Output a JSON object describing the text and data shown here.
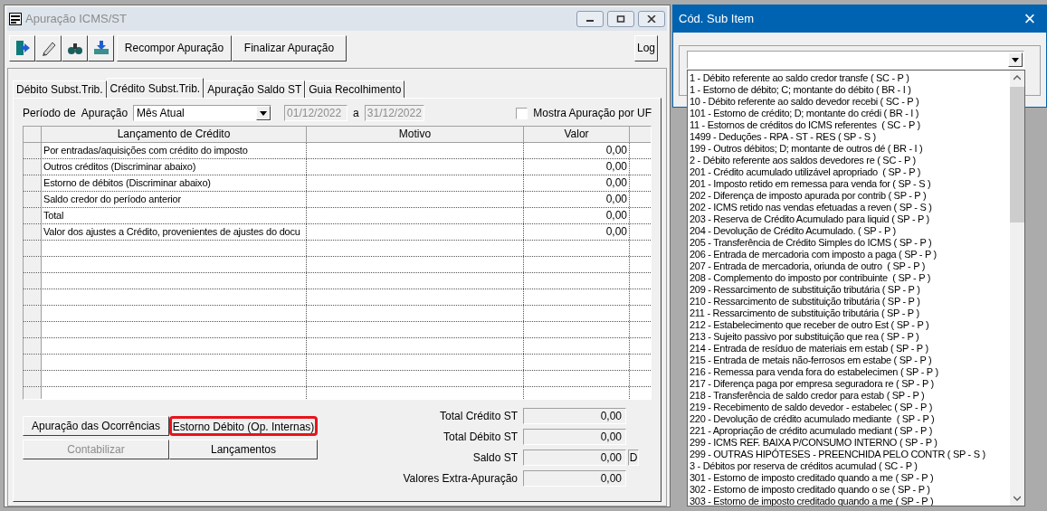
{
  "main_window": {
    "title": "Apuração ICMS/ST",
    "toolbar": {
      "buttons": [
        "Recompor Apuração",
        "Finalizar Apuração"
      ],
      "log_button": "Log"
    },
    "tabs": [
      {
        "label": "Débito Subst.Trib.",
        "selected": false
      },
      {
        "label": "Crédito Subst.Trib.",
        "selected": true
      },
      {
        "label": "Apuração Saldo ST",
        "selected": false
      },
      {
        "label": "Guia Recolhimento",
        "selected": false
      }
    ],
    "period": {
      "label": "Período de  Apuração",
      "value": "Mês Atual",
      "date_from": "01/12/2022",
      "separator": "a",
      "date_to": "31/12/2022",
      "dates_disabled": true
    },
    "show_by_uf": {
      "label": "Mostra Apuração por UF",
      "checked": false
    },
    "table": {
      "columns": [
        "Lançamento de Crédito",
        "Motivo",
        "Valor"
      ],
      "rows": [
        {
          "lancamento": "Por entradas/aquisições com crédito do imposto",
          "valor": "0,00"
        },
        {
          "lancamento": "Outros créditos (Discriminar abaixo)",
          "valor": "0,00"
        },
        {
          "lancamento": "Estorno de débitos (Discriminar abaixo)",
          "valor": "0,00"
        },
        {
          "lancamento": "Saldo credor do período anterior",
          "valor": "0,00"
        },
        {
          "lancamento": "Total",
          "valor": "0,00"
        },
        {
          "lancamento": "Valor dos ajustes a Crédito, provenientes de ajustes do docu",
          "valor": "0,00"
        }
      ]
    },
    "action_buttons": [
      {
        "label": "Apuração das Ocorrências",
        "disabled": false,
        "highlighted": false
      },
      {
        "label": "Estorno Débito (Op. Internas)",
        "disabled": false,
        "highlighted": true
      },
      {
        "label": "Contabilizar",
        "disabled": true,
        "highlighted": false
      },
      {
        "label": "Lançamentos",
        "disabled": false,
        "highlighted": false
      }
    ],
    "totals": [
      {
        "label": "Total Crédito ST",
        "value": "0,00"
      },
      {
        "label": "Total Débito ST",
        "value": "0,00"
      },
      {
        "label": "Saldo ST",
        "value": "0,00",
        "suffix": "D"
      },
      {
        "label": "Valores Extra-Apuração",
        "value": "0,00"
      }
    ]
  },
  "dialog": {
    "title": "Cód. Sub Item",
    "close": "×",
    "options": [
      "1 - Débito referente ao saldo credor transfe ( SC - P )",
      "1 - Estorno de débito; C; montante do débito ( BR - I )",
      "10 - Débito referente ao saldo devedor recebi ( SC - P )",
      "101 - Estorno de crédito; D; montante do crédi ( BR - I )",
      "11 - Estornos de créditos do ICMS referentes  ( SC - P )",
      "1499 - Deduções - RPA - ST - RES ( SP - S )",
      "199 - Outros débitos; D; montante de outros dé ( BR - I )",
      "2 - Débito referente aos saldos devedores re ( SC - P )",
      "201 - Crédito acumulado utilizável apropriado  ( SP - P )",
      "201 - Imposto retido em remessa para venda for ( SP - S )",
      "202 - Diferença de imposto apurada por contrib ( SP - P )",
      "202 - ICMS retido nas vendas efetuadas a reven ( SP - S )",
      "203 - Reserva de Crédito Acumulado para liquid ( SP - P )",
      "204 - Devolução de Crédito Acumulado. ( SP - P )",
      "205 - Transferência de Crédito Simples do ICMS ( SP - P )",
      "206 - Entrada de mercadoria com imposto a paga ( SP - P )",
      "207 - Entrada de mercadoria, oriunda de outro  ( SP - P )",
      "208 - Complemento do imposto por contribuinte  ( SP - P )",
      "209 - Ressarcimento de substituição tributária ( SP - P )",
      "210 - Ressarcimento de substituição tributária ( SP - P )",
      "211 - Ressarcimento de substituição tributária ( SP - P )",
      "212 - Estabelecimento que receber de outro Est ( SP - P )",
      "213 - Sujeito passivo por substituição que rea ( SP - P )",
      "214 - Entrada de resíduo de materiais em estab ( SP - P )",
      "215 - Entrada de metais não-ferrosos em estabe ( SP - P )",
      "216 - Remessa para venda fora do estabelecimen ( SP - P )",
      "217 - Diferença paga por empresa seguradora re ( SP - P )",
      "218 - Transferência de saldo credor para estab ( SP - P )",
      "219 - Recebimento de saldo devedor - estabelec ( SP - P )",
      "220 - Devolução de crédito acumulado mediante  ( SP - P )",
      "221 - Apropriação de crédito acumulado mediant ( SP - P )",
      "299 - ICMS REF. BAIXA P/CONSUMO INTERNO ( SP - P )",
      "299 - OUTRAS HIPÓTESES - PREENCHIDA PELO CONTR ( SP - S )",
      "3 - Débitos por reserva de créditos acumulad ( SC - P )",
      "301 - Estorno de imposto creditado quando a me ( SP - P )",
      "302 - Estorno de imposto creditado quando o se ( SP - P )",
      "303 - Estorno de imposto creditado quando a me ( SP - P )"
    ]
  }
}
